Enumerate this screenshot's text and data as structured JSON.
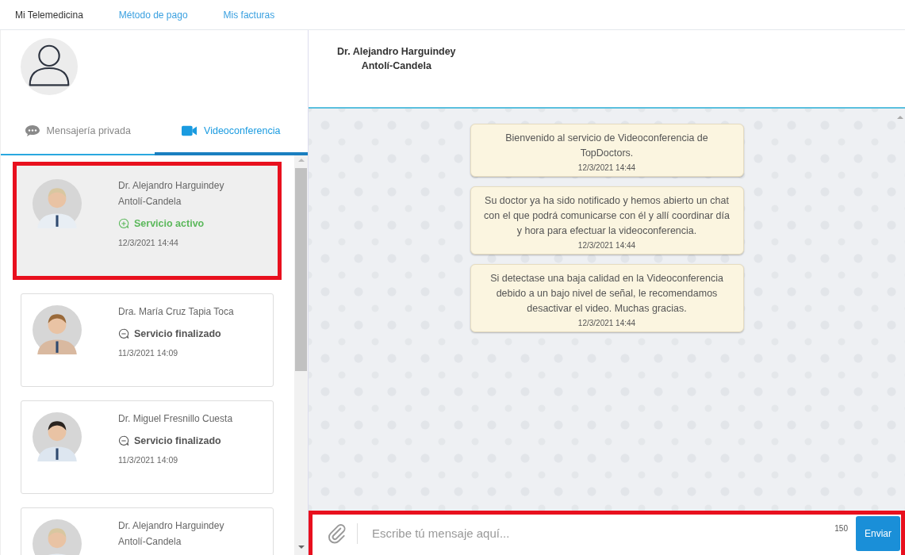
{
  "nav": [
    {
      "label": "Mi Telemedicina",
      "selected": true
    },
    {
      "label": "Método de pago",
      "selected": false
    },
    {
      "label": "Mis facturas",
      "selected": false
    }
  ],
  "tabs": [
    {
      "label": "Mensajería privada",
      "kind": "chat",
      "selected": false
    },
    {
      "label": "Videoconferencia",
      "kind": "video",
      "selected": true
    }
  ],
  "conversations": [
    {
      "name": "Dr. Alejandro Harguindey Antolí-Candela",
      "status": {
        "text": "Servicio activo",
        "kind": "active"
      },
      "date": "12/3/2021 14:44",
      "selected": true,
      "highlighted": true
    },
    {
      "name": "Dra. María Cruz Tapia Toca",
      "status": {
        "text": "Servicio finalizado",
        "kind": "finished"
      },
      "date": "11/3/2021 14:09",
      "selected": false,
      "highlighted": false
    },
    {
      "name": "Dr. Miguel Fresnillo Cuesta",
      "status": {
        "text": "Servicio finalizado",
        "kind": "finished"
      },
      "date": "11/3/2021 14:09",
      "selected": false,
      "highlighted": false
    },
    {
      "name": "Dr. Alejandro Harguindey Antolí-Candela",
      "selected": false,
      "highlighted": false
    }
  ],
  "chat": {
    "doctor_name": "Dr. Alejandro Harguindey\nAntolí-Candela",
    "messages": [
      {
        "text": "Bienvenido al servicio de Videoconferencia de TopDoctors.",
        "time": "12/3/2021 14:44"
      },
      {
        "text": "Su doctor ya ha sido notificado y hemos abierto un chat con el que podrá comunicarse con él y allí coordinar día y hora para efectuar la videoconferencia.",
        "time": "12/3/2021 14:44"
      },
      {
        "text": "Si detectase una baja calidad en la Videoconferencia debido a un bajo nivel de señal, le recomendamos desactivar el video. Muchas gracias.",
        "time": "12/3/2021 14:44"
      }
    ],
    "composer": {
      "placeholder": "Escribe tú mensaje aquí...",
      "counter": "150",
      "send": "Enviar",
      "highlighted": true
    }
  }
}
